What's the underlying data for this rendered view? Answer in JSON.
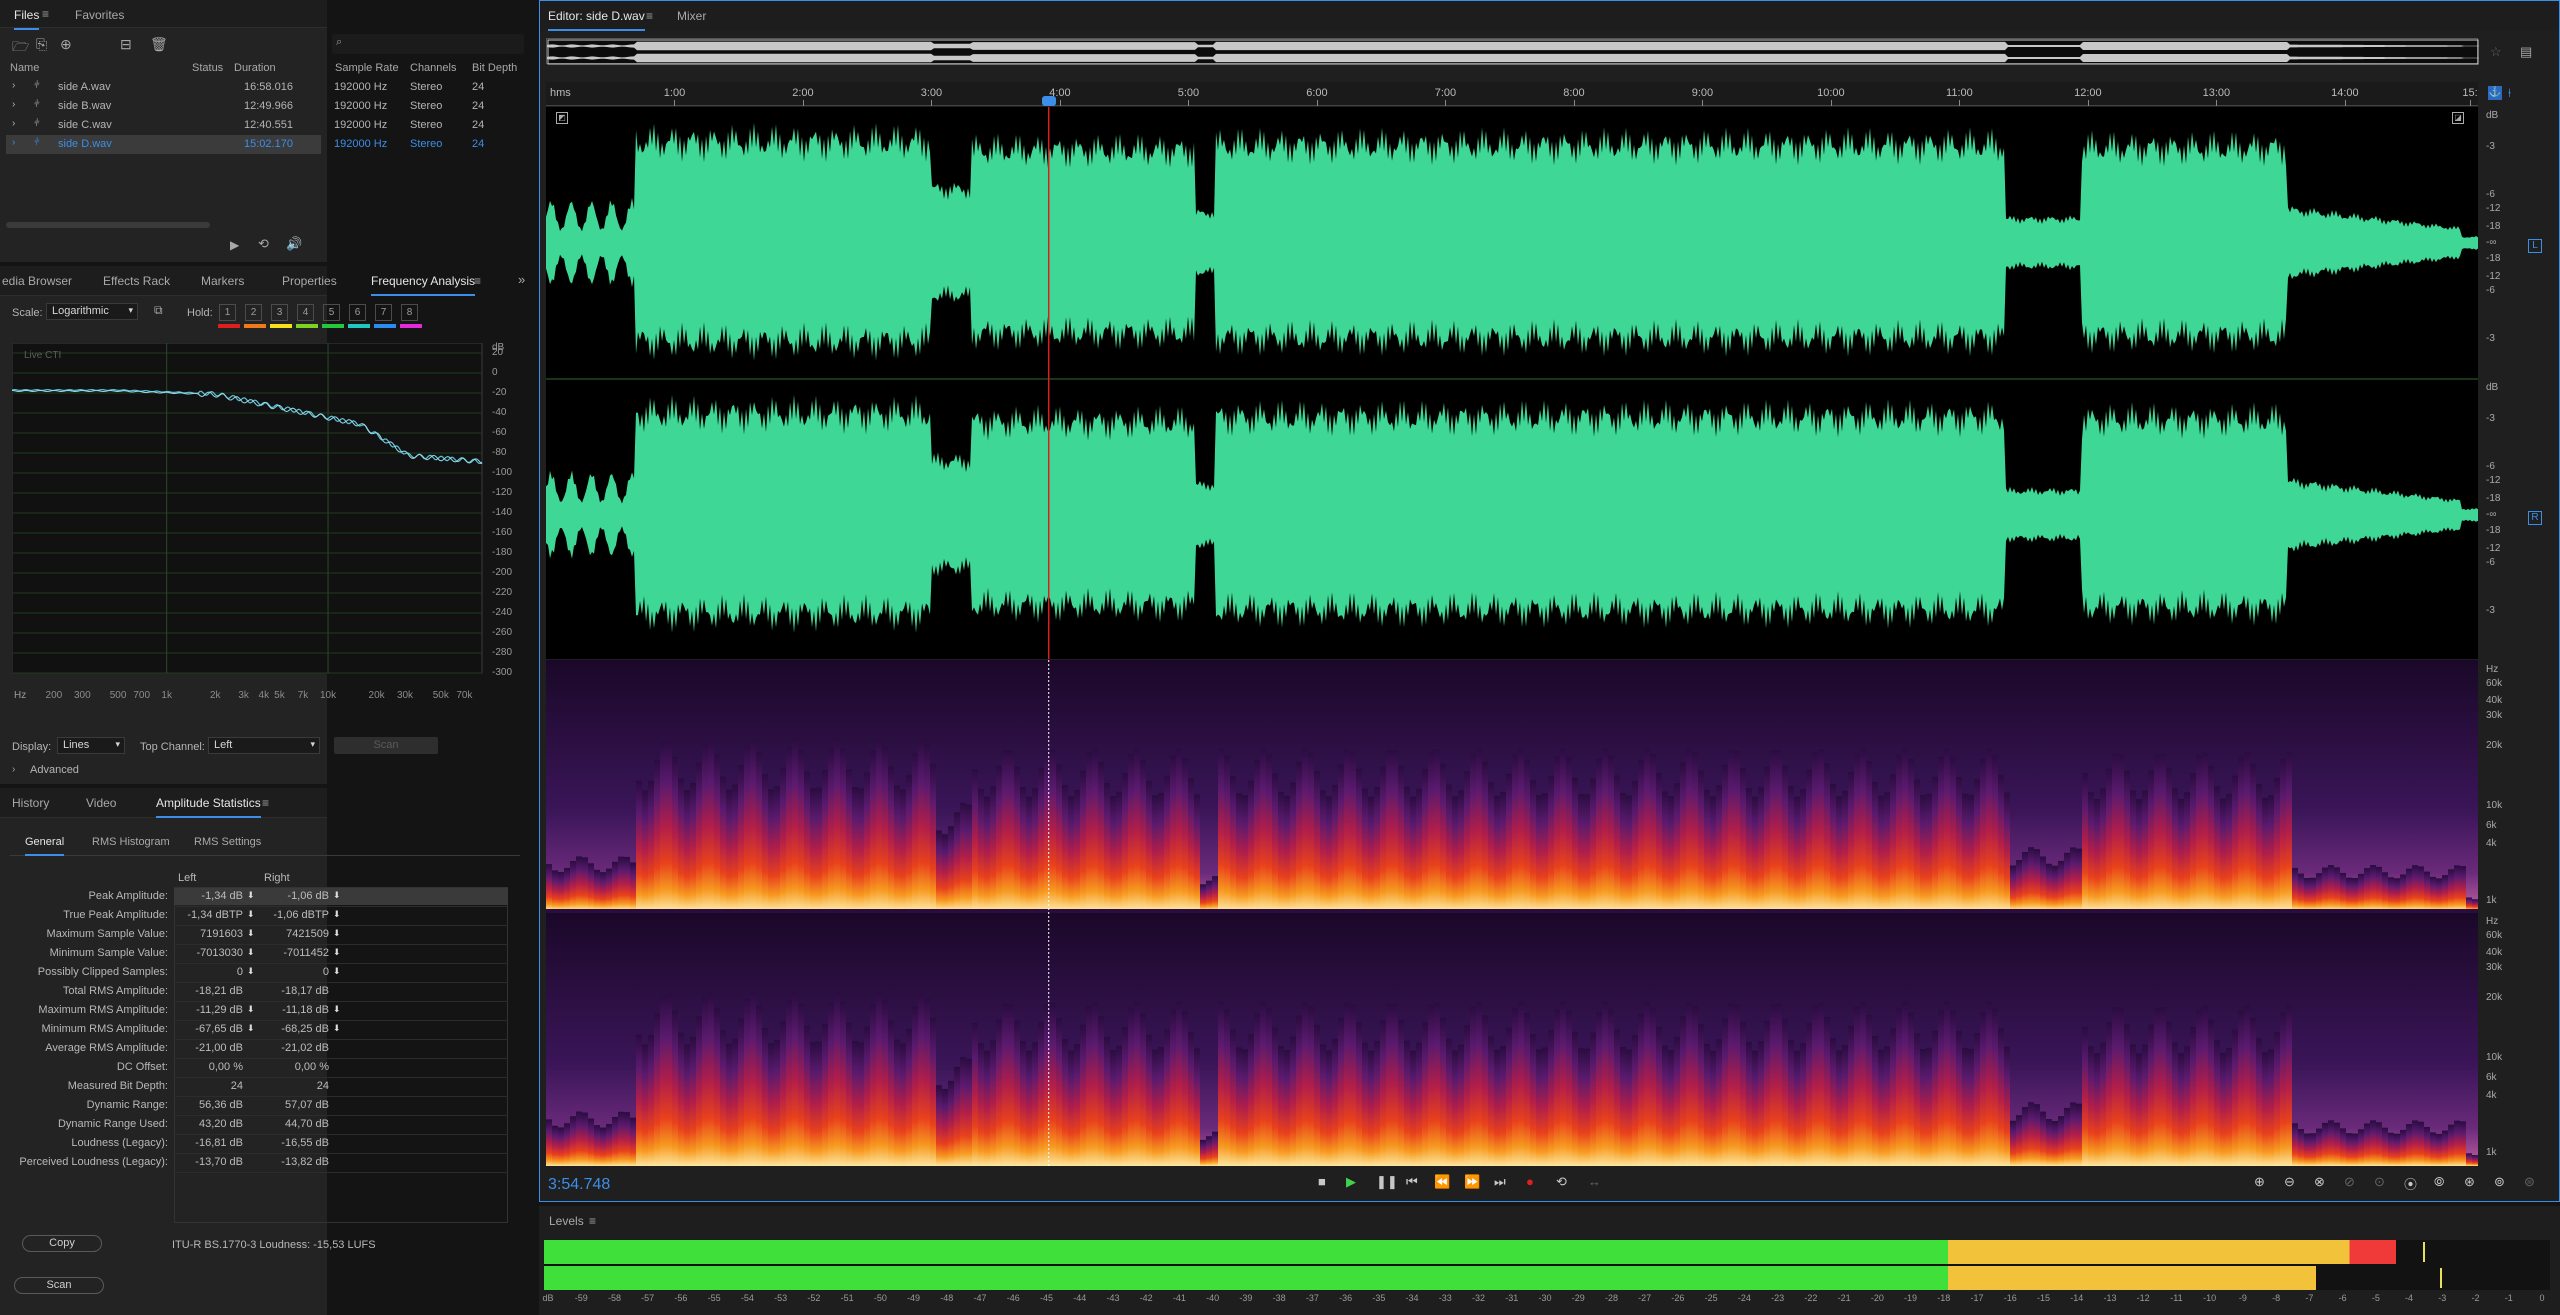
{
  "files_panel": {
    "tabs": [
      "Files",
      "Favorites"
    ],
    "columns": [
      "Name",
      "Status",
      "Duration",
      "Sample Rate",
      "Channels",
      "Bit Depth"
    ],
    "rows": [
      {
        "name": "side A.wav",
        "duration": "16:58.016",
        "rate": "192000 Hz",
        "channels": "Stereo",
        "depth": "24"
      },
      {
        "name": "side B.wav",
        "duration": "12:49.966",
        "rate": "192000 Hz",
        "channels": "Stereo",
        "depth": "24"
      },
      {
        "name": "side C.wav",
        "duration": "12:40.551",
        "rate": "192000 Hz",
        "channels": "Stereo",
        "depth": "24"
      },
      {
        "name": "side D.wav",
        "duration": "15:02.170",
        "rate": "192000 Hz",
        "channels": "Stereo",
        "depth": "24"
      }
    ]
  },
  "freq_panel": {
    "tabs": [
      "edia Browser",
      "Effects Rack",
      "Markers",
      "Properties",
      "Frequency Analysis"
    ],
    "scale_label": "Scale:",
    "scale_value": "Logarithmic",
    "hold_label": "Hold:",
    "hold_buttons": [
      "1",
      "2",
      "3",
      "4",
      "5",
      "6",
      "7",
      "8"
    ],
    "hold_colors": [
      "#e01e1e",
      "#f07a1a",
      "#f5e21b",
      "#7dd321",
      "#23c83d",
      "#1ec7c0",
      "#2a8cf0",
      "#e32ad8"
    ],
    "live_label": "Live CTI",
    "db_unit": "dB",
    "db_ticks": [
      "20",
      "0",
      "-20",
      "-40",
      "-60",
      "-80",
      "-100",
      "-120",
      "-140",
      "-160",
      "-180",
      "-200",
      "-220",
      "-240",
      "-260",
      "-280",
      "-300"
    ],
    "hz_unit": "Hz",
    "freq_ticks": [
      "200",
      "300",
      "500",
      "700",
      "1k",
      "2k",
      "3k",
      "4k",
      "5k",
      "7k",
      "10k",
      "20k",
      "30k",
      "50k",
      "70k"
    ],
    "display_label": "Display:",
    "display_value": "Lines",
    "top_channel_label": "Top Channel:",
    "top_channel_value": "Left",
    "scan_label": "Scan",
    "advanced_label": "Advanced"
  },
  "amp_panel": {
    "tabs": [
      "History",
      "Video",
      "Amplitude Statistics"
    ],
    "subtabs": [
      "General",
      "RMS Histogram",
      "RMS Settings"
    ],
    "col_left": "Left",
    "col_right": "Right",
    "rows": [
      {
        "label": "Peak Amplitude:",
        "left": "-1,34 dB",
        "right": "-1,06 dB"
      },
      {
        "label": "True Peak Amplitude:",
        "left": "-1,34 dBTP",
        "right": "-1,06 dBTP"
      },
      {
        "label": "Maximum Sample Value:",
        "left": "7191603",
        "right": "7421509"
      },
      {
        "label": "Minimum Sample Value:",
        "left": "-7013030",
        "right": "-7011452"
      },
      {
        "label": "Possibly Clipped Samples:",
        "left": "0",
        "right": "0"
      },
      {
        "label": "Total RMS Amplitude:",
        "left": "-18,21 dB",
        "right": "-18,17 dB"
      },
      {
        "label": "Maximum RMS Amplitude:",
        "left": "-11,29 dB",
        "right": "-11,18 dB"
      },
      {
        "label": "Minimum RMS Amplitude:",
        "left": "-67,65 dB",
        "right": "-68,25 dB"
      },
      {
        "label": "Average RMS Amplitude:",
        "left": "-21,00 dB",
        "right": "-21,02 dB"
      },
      {
        "label": "DC Offset:",
        "left": "0,00 %",
        "right": "0,00 %"
      },
      {
        "label": "Measured Bit Depth:",
        "left": "24",
        "right": "24"
      },
      {
        "label": "Dynamic Range:",
        "left": "56,36 dB",
        "right": "57,07 dB"
      },
      {
        "label": "Dynamic Range Used:",
        "left": "43,20 dB",
        "right": "44,70 dB"
      },
      {
        "label": "Loudness (Legacy):",
        "left": "-16,81 dB",
        "right": "-16,55 dB"
      },
      {
        "label": "Perceived Loudness (Legacy):",
        "left": "-13,70 dB",
        "right": "-13,82 dB"
      }
    ],
    "copy_label": "Copy",
    "loudness_text": "ITU-R BS.1770-3 Loudness:  -15,53 LUFS",
    "scan_label": "Scan"
  },
  "editor": {
    "tabs": [
      "Editor: side D.wav",
      "Mixer"
    ],
    "timeline_unit": "hms",
    "timeline_ticks": [
      "1:00",
      "2:00",
      "3:00",
      "4:00",
      "5:00",
      "6:00",
      "7:00",
      "8:00",
      "9:00",
      "10:00",
      "11:00",
      "12:00",
      "13:00",
      "14:00",
      "15:"
    ],
    "db_unit": "dB",
    "db_scale": [
      "-3",
      "-6",
      "-12",
      "-18",
      "-∞",
      "-18",
      "-12",
      "-6",
      "-3"
    ],
    "channel_left": "L",
    "channel_right": "R",
    "hz_unit": "Hz",
    "spec_scale": [
      "60k",
      "40k",
      "30k",
      "20k",
      "10k",
      "6k",
      "4k",
      "1k"
    ],
    "current_time": "3:54.748",
    "playhead_minutes": 3.9125,
    "total_minutes": 15.036,
    "waveform_color": "#3fd795",
    "accent": "#3d8ee8"
  },
  "levels": {
    "title": "Levels",
    "ticks": [
      "dB",
      "-59",
      "-58",
      "-57",
      "-56",
      "-55",
      "-54",
      "-53",
      "-52",
      "-51",
      "-50",
      "-49",
      "-48",
      "-47",
      "-46",
      "-45",
      "-44",
      "-43",
      "-42",
      "-41",
      "-40",
      "-39",
      "-38",
      "-37",
      "-36",
      "-35",
      "-34",
      "-33",
      "-32",
      "-31",
      "-30",
      "-29",
      "-28",
      "-27",
      "-26",
      "-25",
      "-24",
      "-23",
      "-22",
      "-21",
      "-20",
      "-19",
      "-18",
      "-17",
      "-16",
      "-15",
      "-14",
      "-13",
      "-12",
      "-11",
      "-10",
      "-9",
      "-8",
      "-7",
      "-6",
      "-5",
      "-4",
      "-3",
      "-2",
      "-1",
      "0"
    ],
    "left_level_db": -4.6,
    "right_level_db": -7.0,
    "left_peak_db": -3.8,
    "right_peak_db": -3.3
  }
}
